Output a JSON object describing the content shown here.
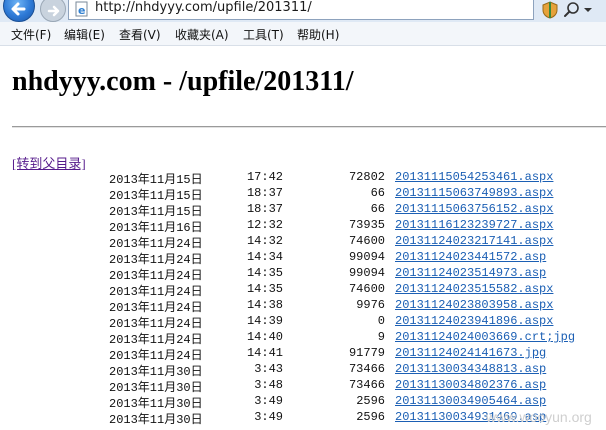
{
  "browser": {
    "url": "http://nhdyyy.com/upfile/201311/"
  },
  "menu": [
    "文件(F)",
    "编辑(E)",
    "查看(V)",
    "收藏夹(A)",
    "工具(T)",
    "帮助(H)"
  ],
  "page": {
    "title": "nhdyyy.com - /upfile/201311/",
    "parent_link": "[转到父目录]"
  },
  "files": [
    {
      "date": "2013年11月15日",
      "time": "17:42",
      "size": "72802",
      "name": "20131115054253461.aspx"
    },
    {
      "date": "2013年11月15日",
      "time": "18:37",
      "size": "66",
      "name": "20131115063749893.aspx"
    },
    {
      "date": "2013年11月15日",
      "time": "18:37",
      "size": "66",
      "name": "20131115063756152.aspx"
    },
    {
      "date": "2013年11月16日",
      "time": "12:32",
      "size": "73935",
      "name": "20131116123239727.aspx"
    },
    {
      "date": "2013年11月24日",
      "time": "14:32",
      "size": "74600",
      "name": "20131124023217141.aspx"
    },
    {
      "date": "2013年11月24日",
      "time": "14:34",
      "size": "99094",
      "name": "20131124023441572.asp"
    },
    {
      "date": "2013年11月24日",
      "time": "14:35",
      "size": "99094",
      "name": "20131124023514973.asp"
    },
    {
      "date": "2013年11月24日",
      "time": "14:35",
      "size": "74600",
      "name": "20131124023515582.aspx"
    },
    {
      "date": "2013年11月24日",
      "time": "14:38",
      "size": "9976",
      "name": "20131124023803958.aspx"
    },
    {
      "date": "2013年11月24日",
      "time": "14:39",
      "size": "0",
      "name": "20131124023941896.aspx"
    },
    {
      "date": "2013年11月24日",
      "time": "14:40",
      "size": "9",
      "name": "20131124024003669.crt;jpg"
    },
    {
      "date": "2013年11月24日",
      "time": "14:41",
      "size": "91779",
      "name": "20131124024141673.jpg"
    },
    {
      "date": "2013年11月30日",
      "time": "3:43",
      "size": "73466",
      "name": "20131130034348813.asp"
    },
    {
      "date": "2013年11月30日",
      "time": "3:48",
      "size": "73466",
      "name": "20131130034802376.asp"
    },
    {
      "date": "2013年11月30日",
      "time": "3:49",
      "size": "2596",
      "name": "20131130034905464.asp"
    },
    {
      "date": "2013年11月30日",
      "time": "3:49",
      "size": "2596",
      "name": "20131130034931469.asp"
    }
  ],
  "watermark": "www.wooyun.org",
  "icons": {
    "back": "back-arrow-icon",
    "forward": "forward-arrow-icon",
    "page": "ie-page-icon",
    "compat": "compatibility-view-icon",
    "search": "search-icon",
    "dropdown": "chevron-down-icon"
  },
  "colors": {
    "link": "#1b5fb4",
    "visited_link": "#551a8b",
    "chrome": "#dfe9f5"
  }
}
